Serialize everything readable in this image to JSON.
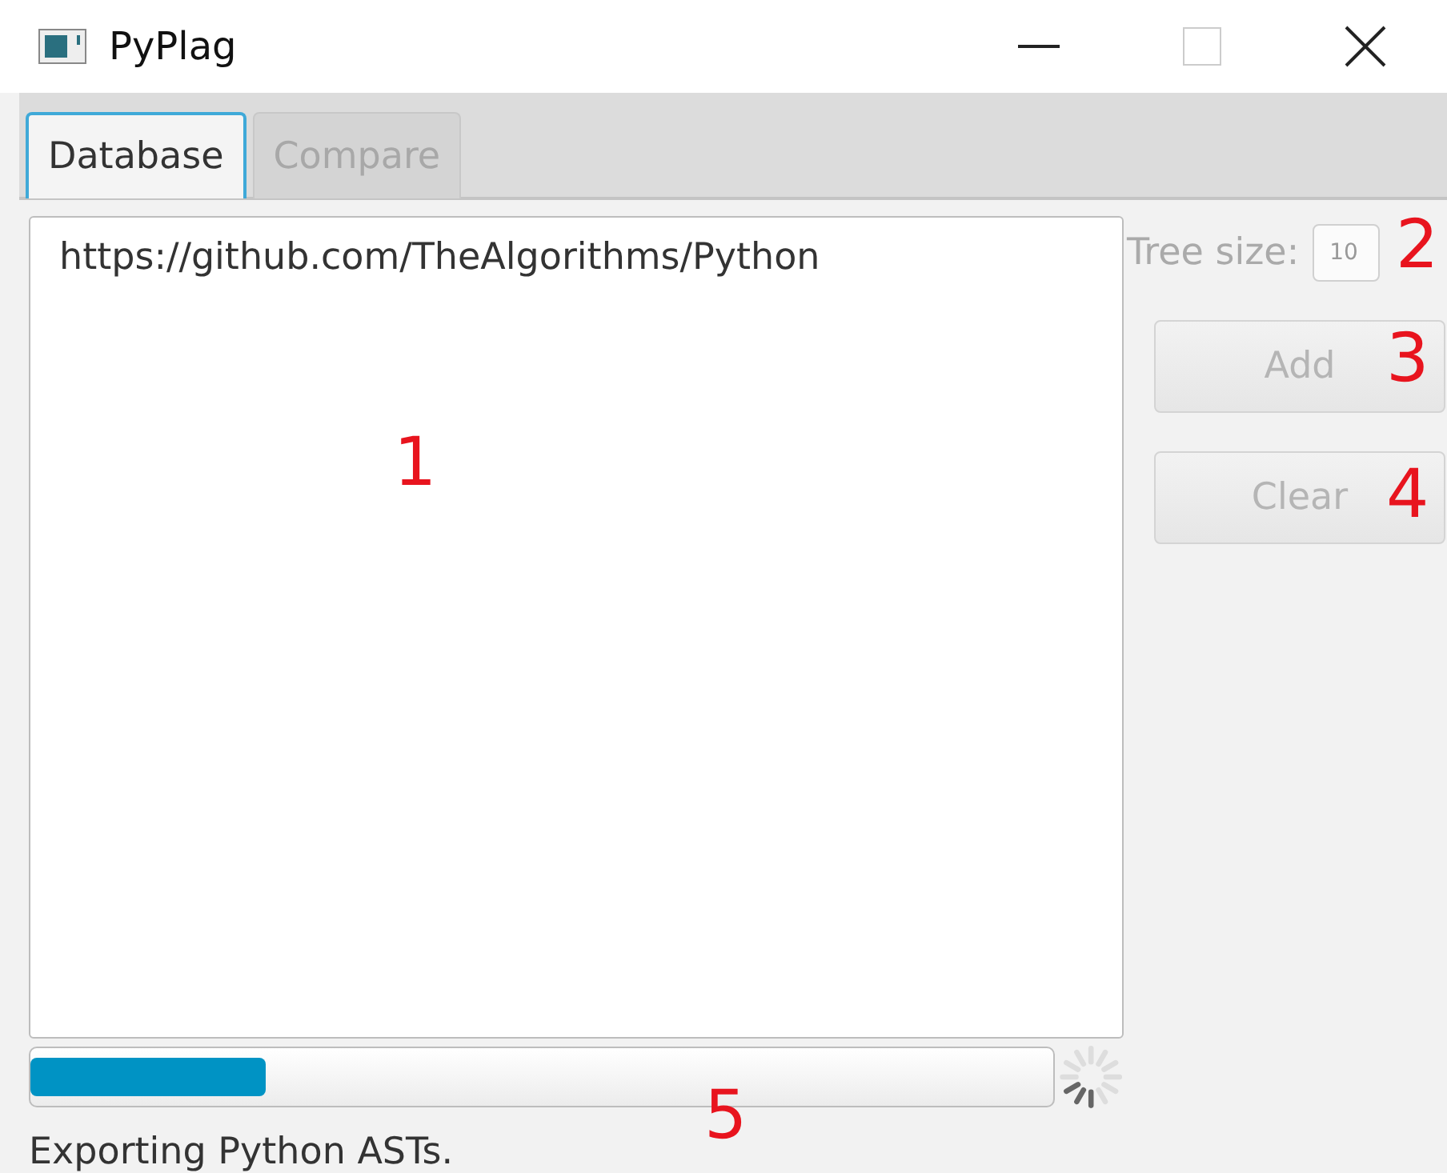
{
  "window": {
    "title": "PyPlag"
  },
  "tabs": [
    {
      "label": "Database",
      "selected": true
    },
    {
      "label": "Compare",
      "selected": false
    }
  ],
  "repository_list": {
    "items": [
      "https://github.com/TheAlgorithms/Python"
    ]
  },
  "tree_size": {
    "label": "Tree size:",
    "value": "10",
    "disabled": true
  },
  "buttons": [
    {
      "label": "Add",
      "disabled": true
    },
    {
      "label": "Clear",
      "disabled": true
    }
  ],
  "progress": {
    "level": 0.23
  },
  "status": "Exporting Python ASTs.",
  "annotations": [
    {
      "kind": "list",
      "text": "1"
    },
    {
      "kind": "field",
      "text": "2"
    },
    {
      "kind": "add",
      "text": "3"
    },
    {
      "kind": "clear",
      "text": "4"
    },
    {
      "kind": "progress",
      "text": "5"
    }
  ]
}
